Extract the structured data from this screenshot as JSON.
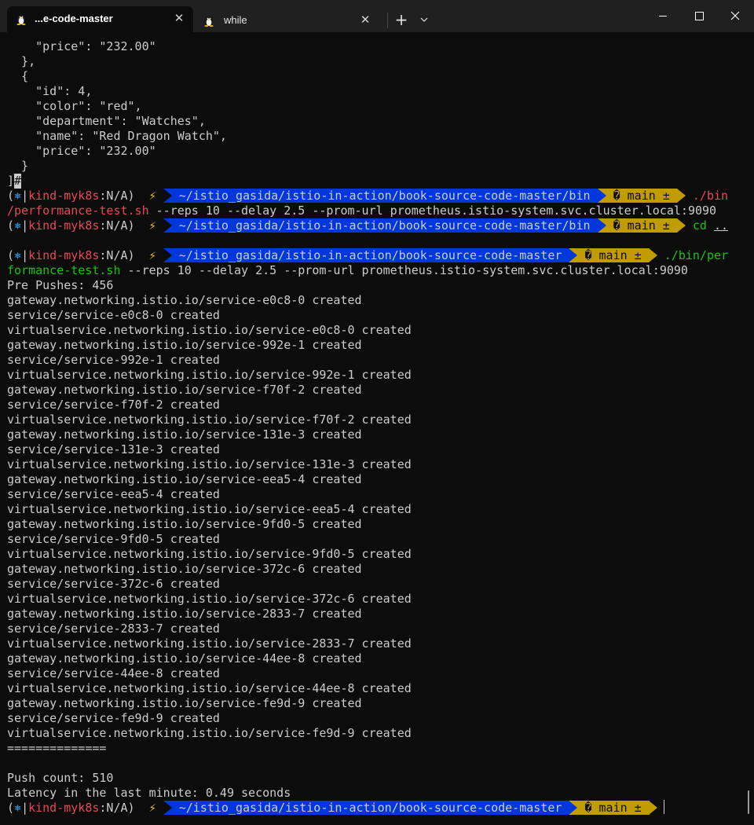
{
  "window": {
    "tabs": [
      {
        "title": "...e-code-master",
        "icon": "linux-penguin-icon",
        "active": true
      },
      {
        "title": "while",
        "icon": "linux-penguin-icon",
        "active": false
      }
    ],
    "new_tab_label": "+",
    "dropdown_label": "⌄",
    "close_glyph": "✕"
  },
  "prompt": {
    "open_paren": "(",
    "k8s_icon": "⎈",
    "context": "kind-myk8s",
    "ns": ":N/A",
    "close_paren": ")",
    "bolt": "⚡",
    "path_bin": " ~/istio_gasida/istio-in-action/book-source-code-master/bin ",
    "path_root": " ~/istio_gasida/istio-in-action/book-source-code-master ",
    "branch": " � main ± "
  },
  "json_block": [
    "    \"price\": \"232.00\"",
    "  },",
    "  {",
    "    \"id\": 4,",
    "    \"color\": \"red\",",
    "    \"department\": \"Watches\",",
    "    \"name\": \"Red Dragon Watch\",",
    "    \"price\": \"232.00\"",
    "  }",
    "]"
  ],
  "cmd1_tail_red": "./bin",
  "cmd1_line2_red": "/performance-test.sh",
  "cmd1_line2_args": " --reps 10 --delay 2.5 --prom-url prometheus.istio-system.svc.cluster.local:9090",
  "cmd2_cd": "cd",
  "cmd2_arg": "..",
  "cmd3_tail_green": "./bin/per",
  "cmd3_line2_green": "formance-test.sh",
  "cmd3_line2_args": " --reps 10 --delay 2.5 --prom-url prometheus.istio-system.svc.cluster.local:9090",
  "output": [
    "Pre Pushes: 456",
    "gateway.networking.istio.io/service-e0c8-0 created",
    "service/service-e0c8-0 created",
    "virtualservice.networking.istio.io/service-e0c8-0 created",
    "gateway.networking.istio.io/service-992e-1 created",
    "service/service-992e-1 created",
    "virtualservice.networking.istio.io/service-992e-1 created",
    "gateway.networking.istio.io/service-f70f-2 created",
    "service/service-f70f-2 created",
    "virtualservice.networking.istio.io/service-f70f-2 created",
    "gateway.networking.istio.io/service-131e-3 created",
    "service/service-131e-3 created",
    "virtualservice.networking.istio.io/service-131e-3 created",
    "gateway.networking.istio.io/service-eea5-4 created",
    "service/service-eea5-4 created",
    "virtualservice.networking.istio.io/service-eea5-4 created",
    "gateway.networking.istio.io/service-9fd0-5 created",
    "service/service-9fd0-5 created",
    "virtualservice.networking.istio.io/service-9fd0-5 created",
    "gateway.networking.istio.io/service-372c-6 created",
    "service/service-372c-6 created",
    "virtualservice.networking.istio.io/service-372c-6 created",
    "gateway.networking.istio.io/service-2833-7 created",
    "service/service-2833-7 created",
    "virtualservice.networking.istio.io/service-2833-7 created",
    "gateway.networking.istio.io/service-44ee-8 created",
    "service/service-44ee-8 created",
    "virtualservice.networking.istio.io/service-44ee-8 created",
    "gateway.networking.istio.io/service-fe9d-9 created",
    "service/service-fe9d-9 created",
    "virtualservice.networking.istio.io/service-fe9d-9 created",
    "==============",
    "",
    "Push count: 510",
    "Latency in the last minute: 0.49 seconds"
  ],
  "colors": {
    "background": "#0c0c0c",
    "titlebar": "#202020",
    "foreground": "#cccccc",
    "red": "#e74856",
    "green": "#16c60c",
    "powerline_blue": "#0037da",
    "powerline_yellow": "#c19c00"
  }
}
